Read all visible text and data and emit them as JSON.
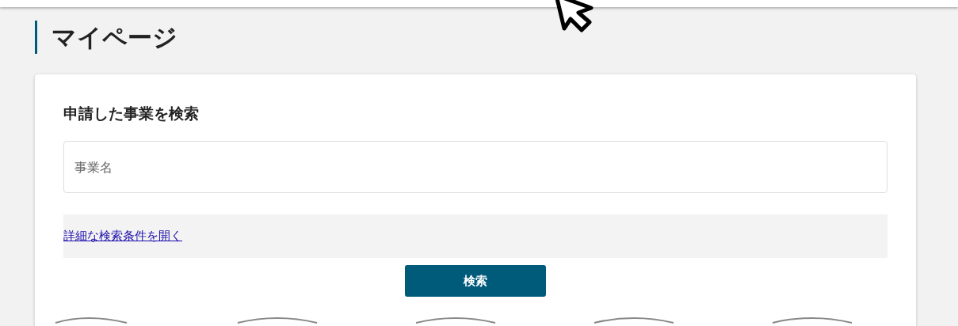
{
  "page_title": "マイページ",
  "search": {
    "heading": "申請した事業を検索",
    "field": {
      "placeholder": "事業名"
    },
    "advanced_link": "詳細な検索条件を開く",
    "button": "検索"
  }
}
